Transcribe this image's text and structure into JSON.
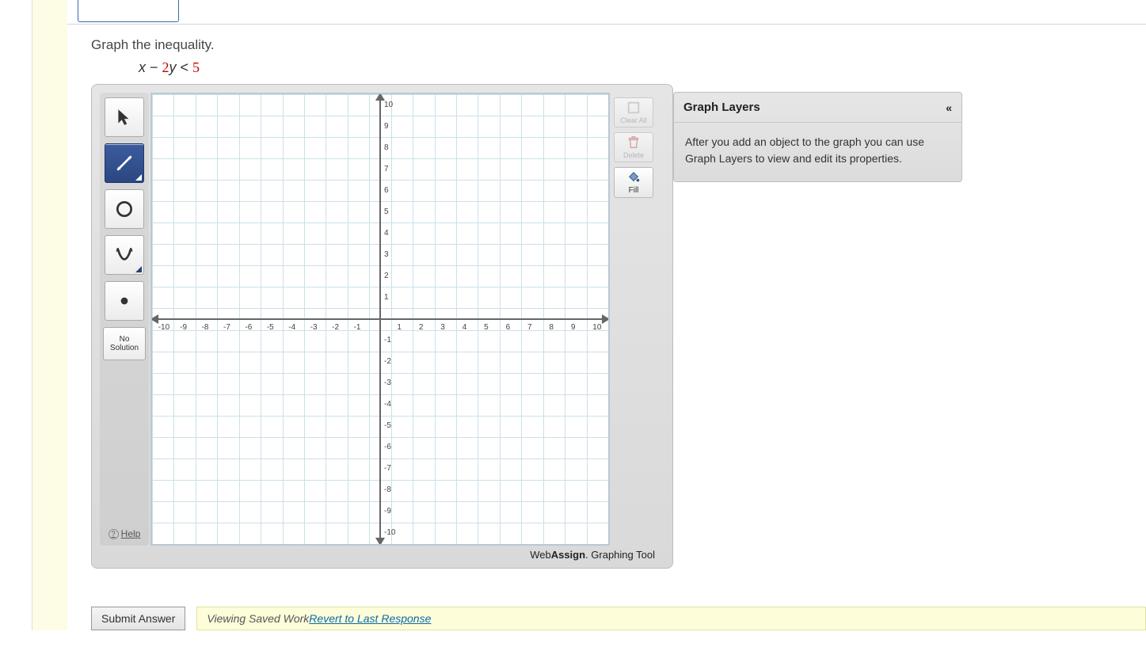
{
  "question": {
    "prompt": "Graph the inequality.",
    "formula_lhs_x": "x",
    "formula_minus": " − ",
    "formula_coef": "2",
    "formula_y": "y",
    "formula_lt": " < ",
    "formula_rhs": "5"
  },
  "tools": {
    "pointer": "pointer-tool",
    "line": "line-tool",
    "circle": "circle-tool",
    "curve": "parabola-tool",
    "point": "point-tool",
    "nosolution_line1": "No",
    "nosolution_line2": "Solution",
    "help": "Help"
  },
  "rightButtons": {
    "clear": "Clear All",
    "delete": "Delete",
    "fill": "Fill"
  },
  "grid": {
    "min": -10,
    "max": 10,
    "x_labels": [
      "-10",
      "-9",
      "-8",
      "-7",
      "-6",
      "-5",
      "-4",
      "-3",
      "-2",
      "-1",
      "1",
      "2",
      "3",
      "4",
      "5",
      "6",
      "7",
      "8",
      "9",
      "10"
    ],
    "y_labels": [
      "10",
      "9",
      "8",
      "7",
      "6",
      "5",
      "4",
      "3",
      "2",
      "1",
      "-1",
      "-2",
      "-3",
      "-4",
      "-5",
      "-6",
      "-7",
      "-8",
      "-9",
      "-10"
    ]
  },
  "brand": {
    "web": "Web",
    "assign": "Assign",
    "dot": ".",
    "tool": " Graphing Tool"
  },
  "layers": {
    "title": "Graph Layers",
    "body": "After you add an object to the graph you can use Graph Layers to view and edit its properties."
  },
  "footer": {
    "submit": "Submit Answer",
    "viewing": "Viewing Saved Work ",
    "revert": "Revert to Last Response"
  }
}
